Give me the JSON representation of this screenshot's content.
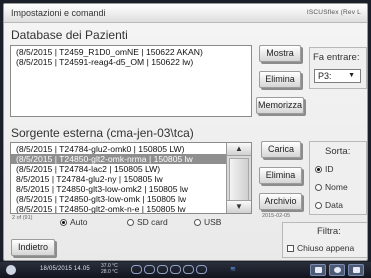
{
  "window": {
    "title": "Impostazioni e comandi",
    "brand": "ISCUSflex (Rev L"
  },
  "patient_db": {
    "label": "Database dei Pazienti",
    "items": [
      "(8/5/2015 | T2459_R1D0_omNE | 150622 AKAN)",
      "(8/5/2015 | T24591-reag4-d5_OM | 150622 lw)"
    ]
  },
  "patient_actions": {
    "show": "Mostra",
    "delete": "Elimina",
    "store": "Memorizza"
  },
  "enter_box": {
    "label": "Fa entrare:",
    "selected": "P3:"
  },
  "external_source": {
    "label": "Sorgente esterna (cma-jen-03\\tca)",
    "items": [
      "(8/5/2015 | T24784-glu2-omk0 | 150805 LW)",
      "(8/5/2015 | T24850-glt2-omk-nrma | 150805 lw",
      "(8/5/2015 | T24784-lac2 | 150805 LW)",
      "8/5/2015 | T24784-glu2-ny | 150805 lw",
      "8/5/2015 | T24850-glt3-low-omk2 | 150805 lw",
      "(8/5/2015 | T24850-glt3-low-omk | 150805 lw",
      "(8/5/2015 | T24850-glt2-omk-n-e | 150805 lw"
    ],
    "selected_index": 1,
    "count": "2 of (91)",
    "source_options": [
      "Auto",
      "SD card",
      "USB"
    ],
    "source_selected": "Auto"
  },
  "source_actions": {
    "load": "Carica",
    "delete": "Elimina",
    "archive": "Archivio",
    "archive_date": "2015-02-05"
  },
  "sort_box": {
    "label": "Sorta:",
    "options": [
      "ID",
      "Nome",
      "Data"
    ],
    "selected": "ID"
  },
  "filter_box": {
    "label": "Filtra:",
    "checkbox_label": "Chiuso appena",
    "checked": false
  },
  "back_button": "Indietro",
  "taskbar": {
    "datetime": "18/05/2015 14.05",
    "temp_1": "37.0 °C",
    "temp_2": "28.0 °C",
    "icons": [
      "analyzer-icon",
      "settings-icon",
      "help-icon"
    ]
  },
  "colors": {
    "selection": "#8f8f8f",
    "taskbar": "#1b1f2a",
    "accent": "#5ea0ff"
  }
}
